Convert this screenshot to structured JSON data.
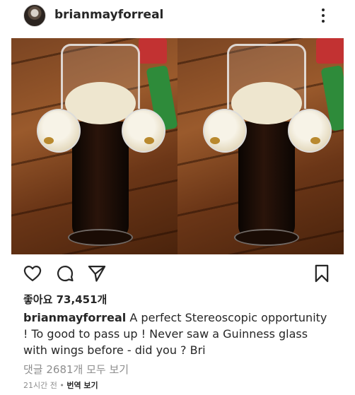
{
  "header": {
    "username": "brianmayforreal",
    "more_icon": "more-vertical-icon"
  },
  "photo": {
    "subject": "stereoscopic pair of Guinness pint glasses with foam wings"
  },
  "actions": {
    "like_icon": "heart-icon",
    "comment_icon": "comment-icon",
    "share_icon": "send-icon",
    "save_icon": "bookmark-icon"
  },
  "post": {
    "likes_text": "좋아요 73,451개",
    "caption_user": "brianmayforreal",
    "caption_text": " A perfect Stereoscopic opportunity ! To good to pass up ! Never saw a Guinness glass with wings before - did you ? Bri",
    "comments_link": "댓글 2681개 모두 보기",
    "time_ago": "21시간 전",
    "separator": " • ",
    "translate_link": "번역 보기"
  }
}
